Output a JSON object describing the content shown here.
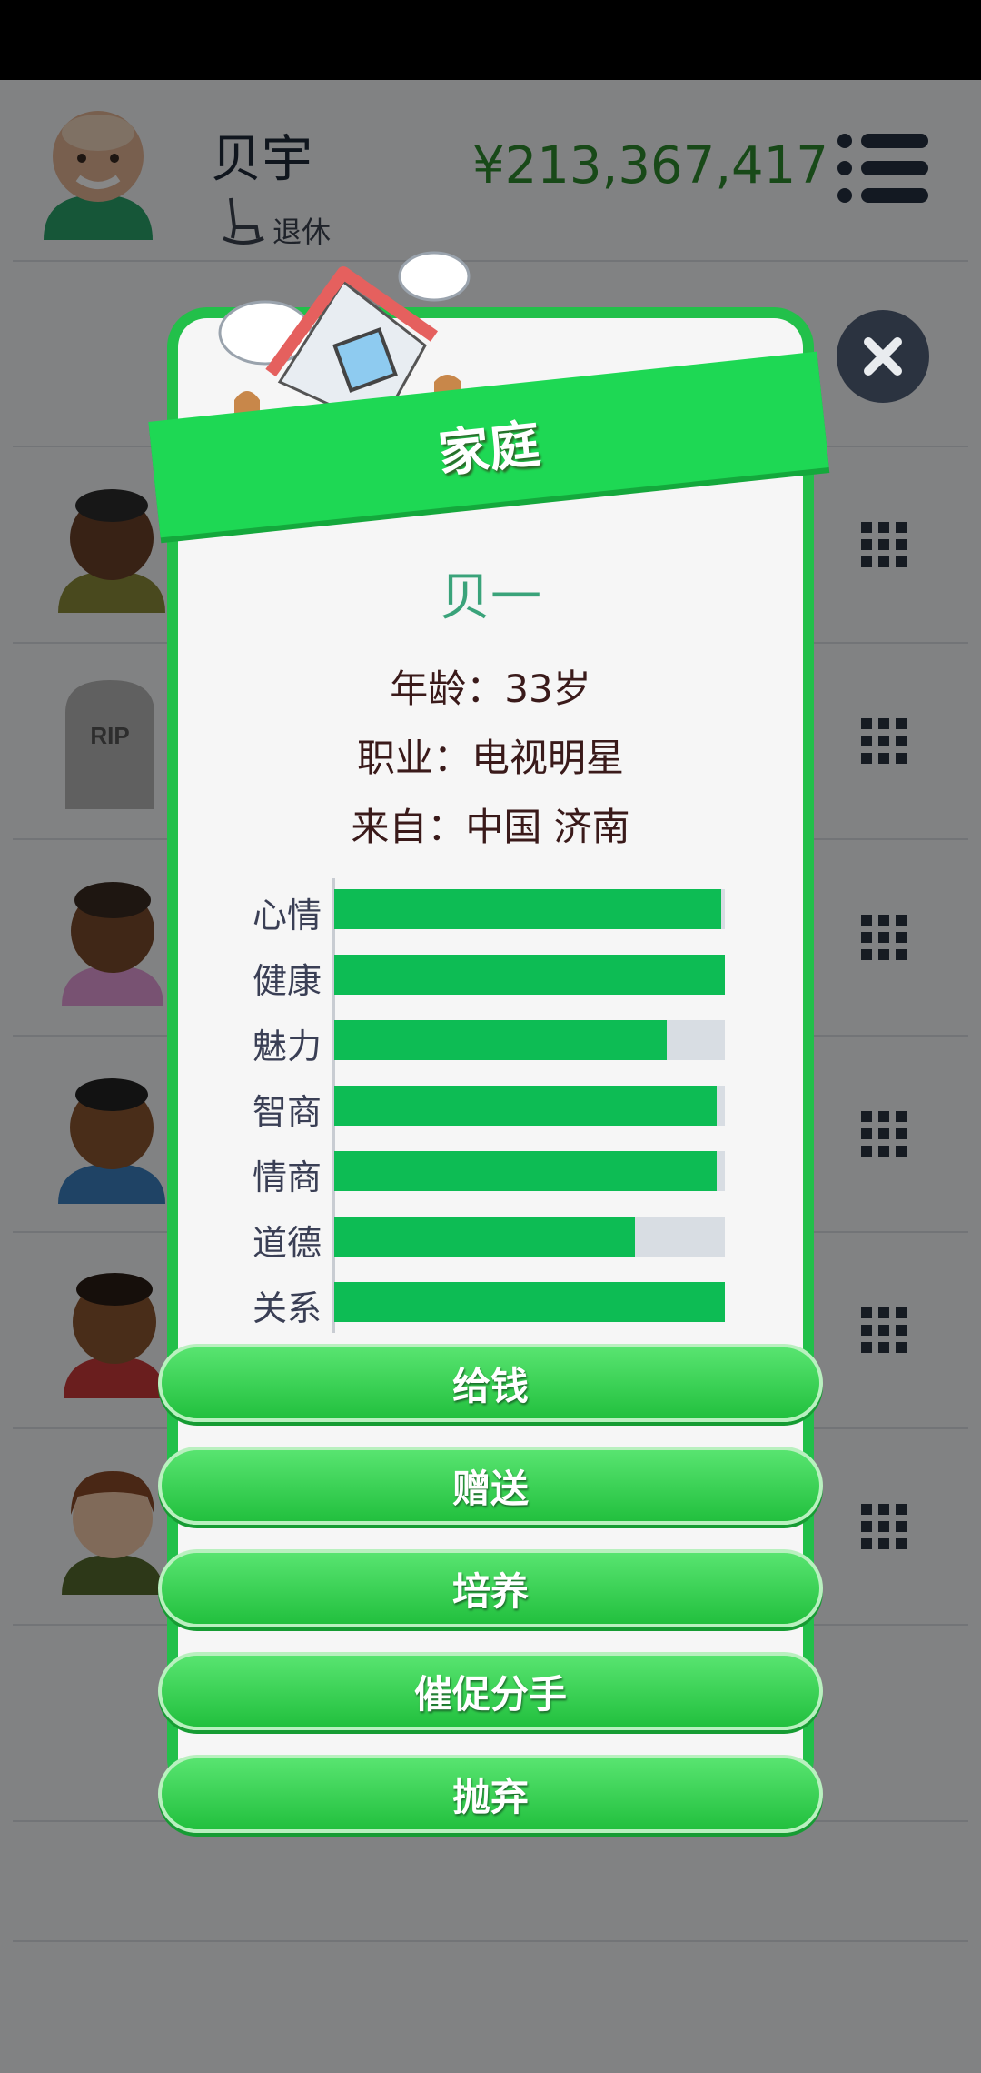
{
  "header": {
    "name": "贝宇",
    "status": "退休",
    "money": "¥213,367,417"
  },
  "icons": {
    "menu": "menu-list-icon",
    "close": "close-icon",
    "row_action": "grid-icon",
    "status": "rocking-chair-icon"
  },
  "dialog": {
    "title": "家庭",
    "person_name": "贝一",
    "age": "年龄：33岁",
    "job": "职业：电视明星",
    "origin": "来自：中国 济南",
    "stats": [
      {
        "label": "心情",
        "value": 0.99
      },
      {
        "label": "健康",
        "value": 1.0
      },
      {
        "label": "魅力",
        "value": 0.85
      },
      {
        "label": "智商",
        "value": 0.98
      },
      {
        "label": "情商",
        "value": 0.98
      },
      {
        "label": "道德",
        "value": 0.77
      },
      {
        "label": "关系",
        "value": 1.0
      }
    ],
    "buttons": [
      "给钱",
      "赠送",
      "培养",
      "催促分手",
      "抛弃"
    ]
  },
  "colors": {
    "accent_green": "#1ed854",
    "money_green": "#2e8b2e",
    "bar_fill": "#0dbc54",
    "bar_track": "#d8dde3",
    "close_bg": "#2b3340"
  }
}
